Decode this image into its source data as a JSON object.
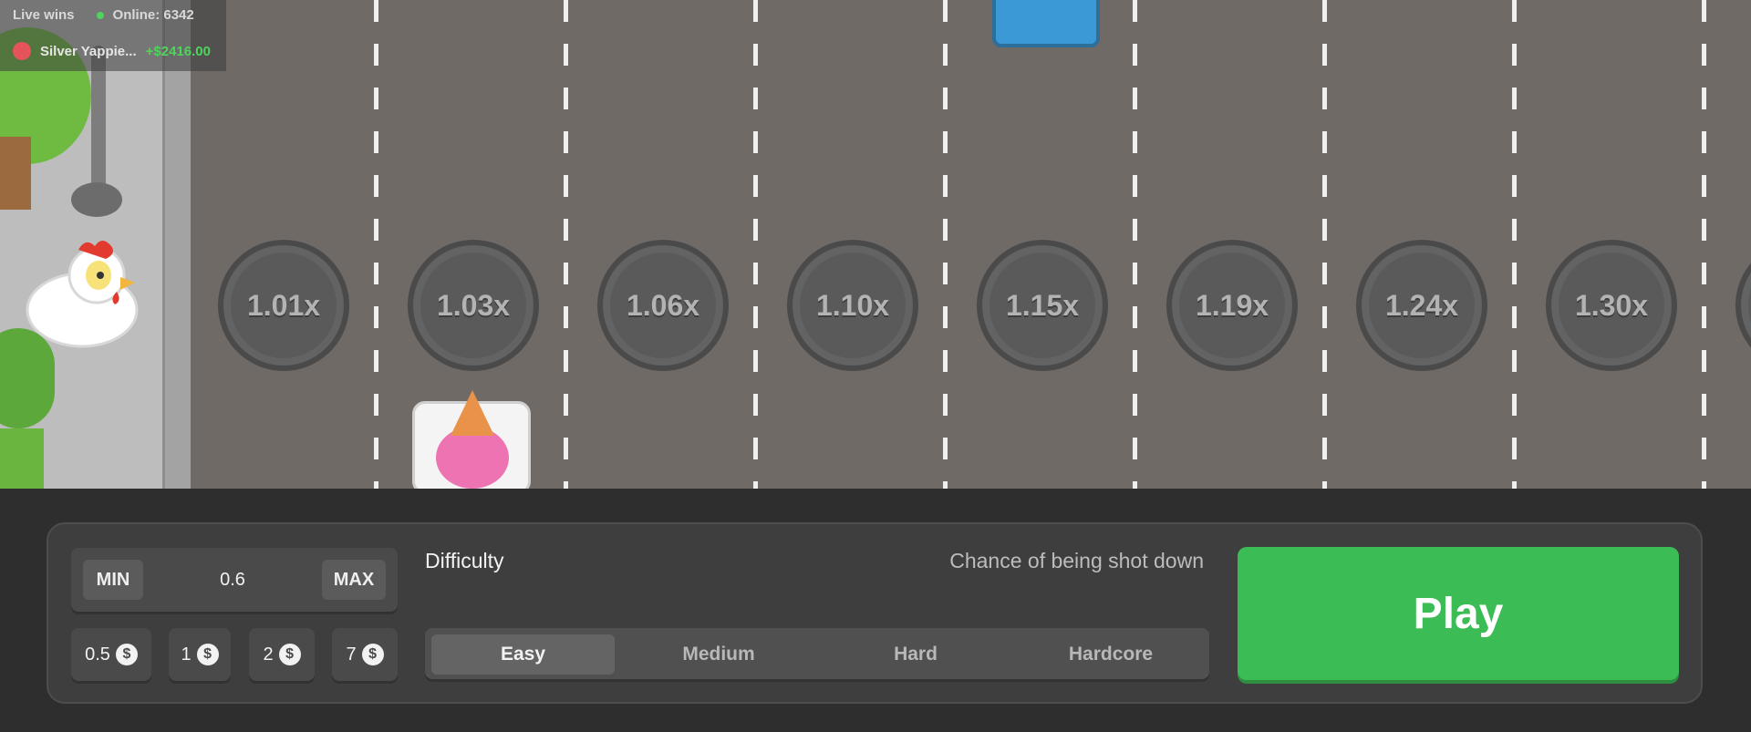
{
  "live": {
    "label": "Live wins",
    "online": "Online: 6342",
    "winner_name": "Silver Yappie...",
    "winner_amount": "+$2416.00"
  },
  "multipliers": [
    "1.01x",
    "1.03x",
    "1.06x",
    "1.10x",
    "1.15x",
    "1.19x",
    "1.24x",
    "1.30x"
  ],
  "bet": {
    "min_label": "MIN",
    "max_label": "MAX",
    "value": "0.6",
    "chips": [
      "0.5",
      "1",
      "2",
      "7"
    ],
    "coin_symbol": "$"
  },
  "difficulty": {
    "label": "Difficulty",
    "chance_label": "Chance of being shot down",
    "options": [
      "Easy",
      "Medium",
      "Hard",
      "Hardcore"
    ],
    "selected": "Easy"
  },
  "play_label": "Play",
  "colors": {
    "accent": "#3cbc54",
    "road": "#706a67",
    "panel": "#3e3e3e",
    "win": "#4fd35c"
  }
}
